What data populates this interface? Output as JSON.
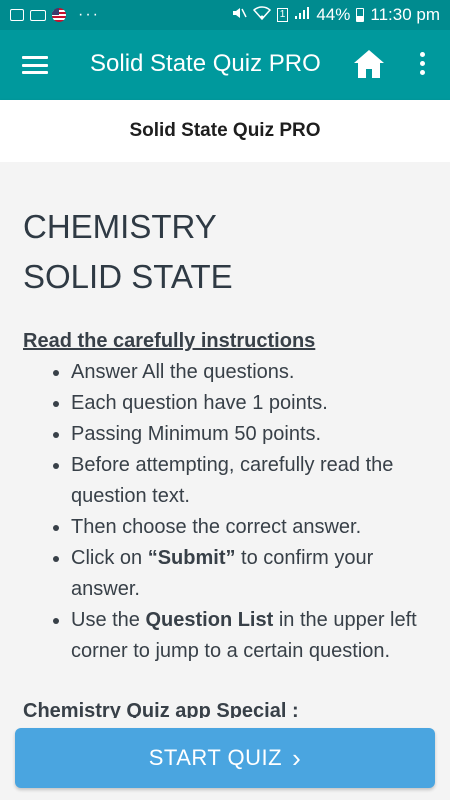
{
  "status_bar": {
    "battery_percent": "44%",
    "time": "11:30 pm",
    "sim": "1",
    "icons": [
      "image-icon",
      "laptop-icon",
      "flag-icon",
      "more-dots",
      "mute-icon",
      "wifi-icon",
      "sim-icon",
      "signal-icon",
      "battery-icon"
    ]
  },
  "app_bar": {
    "title": "Solid State Quiz PRO",
    "icons": [
      "menu-icon",
      "home-icon",
      "overflow-icon"
    ]
  },
  "subheader": {
    "title": "Solid State Quiz PRO"
  },
  "content": {
    "heading_line1": "CHEMISTRY",
    "heading_line2": "SOLID STATE",
    "instructions_title": "Read the carefully instructions",
    "rules": {
      "r1": "Answer All the questions.",
      "r2": "Each question have 1 points.",
      "r3": "Passing Minimum 50 points.",
      "r4": "Before attempting, carefully read the question text.",
      "r5": "Then choose the correct answer.",
      "r6_pre": "Click on ",
      "r6_bold": "“Submit”",
      "r6_post": " to confirm your answer.",
      "r7_pre": "Use the ",
      "r7_bold": "Question List",
      "r7_post": " in the upper left corner to jump to a certain question."
    },
    "special_title": "Chemistry Quiz app Special :"
  },
  "start_button": {
    "label": "START QUIZ",
    "chevron": "›"
  },
  "colors": {
    "status_bar": "#008b8f",
    "app_bar": "#00999d",
    "button": "#4aa5e0",
    "text": "#384048"
  }
}
